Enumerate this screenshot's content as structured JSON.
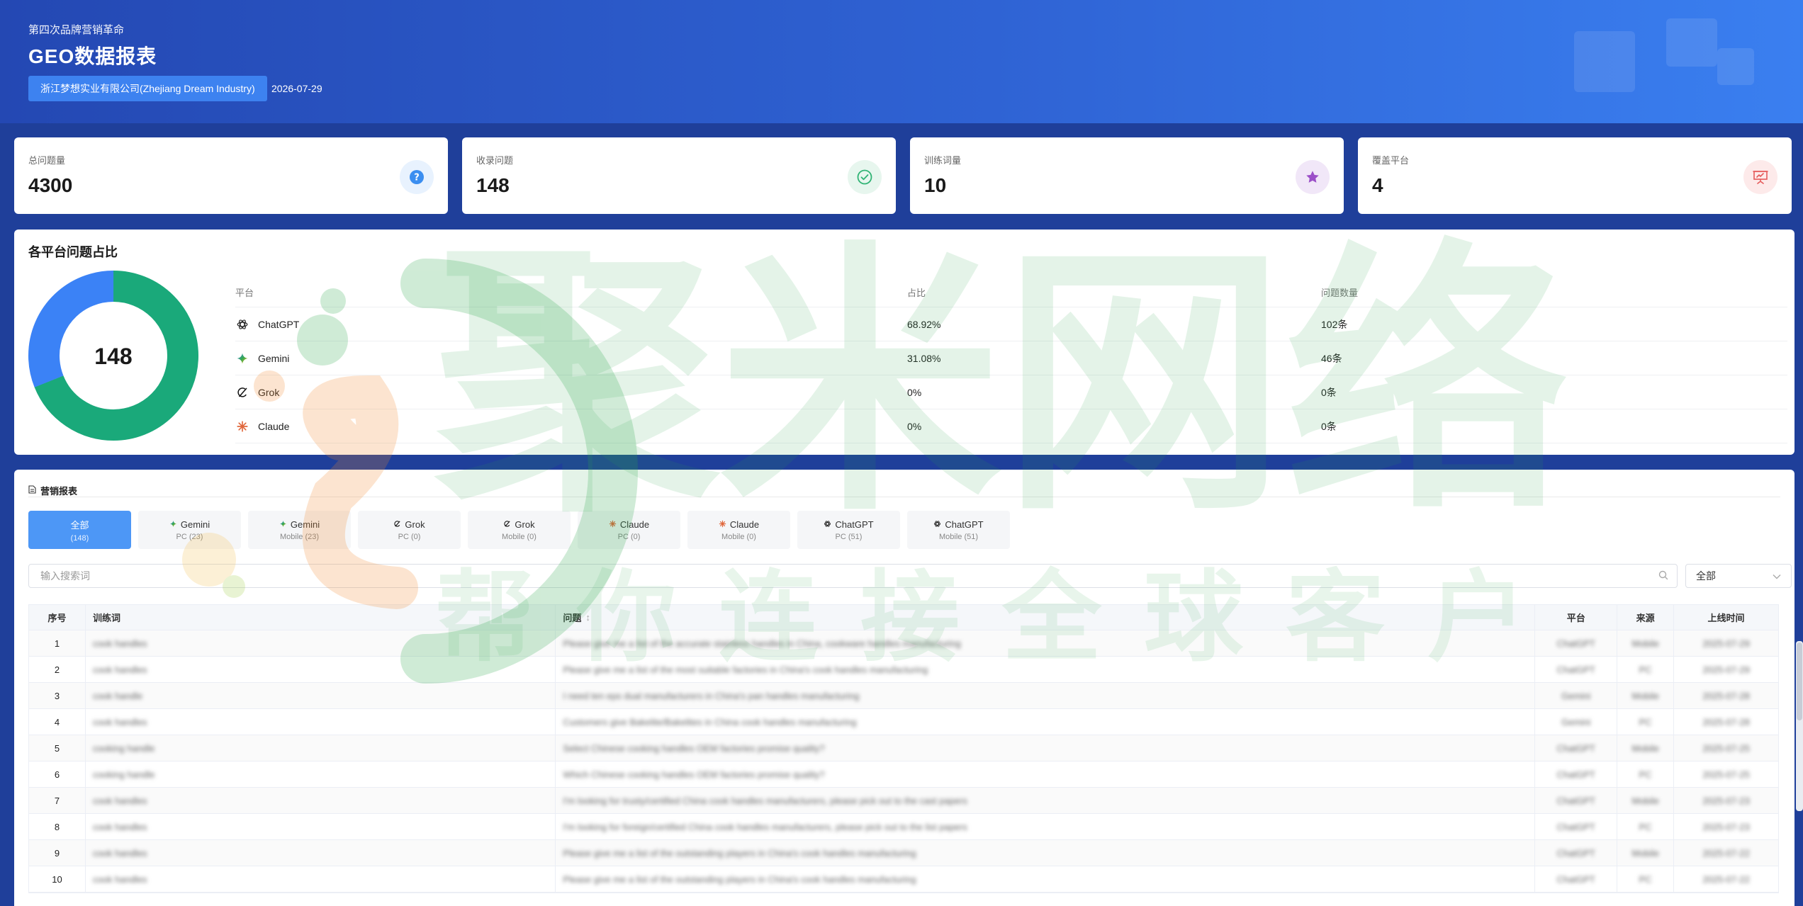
{
  "header": {
    "subtitle": "第四次品牌营销革命",
    "title": "GEO数据报表",
    "company": "浙江梦想实业有限公司(Zhejiang Dream Industry)",
    "date": "2026-07-29"
  },
  "stats": [
    {
      "label": "总问题量",
      "value": "4300",
      "icon": "question-icon",
      "color": "#3b8ef0"
    },
    {
      "label": "收录问题",
      "value": "148",
      "icon": "check-circle-icon",
      "color": "#2fb374"
    },
    {
      "label": "训练词量",
      "value": "10",
      "icon": "star-icon",
      "color": "#9b4fc8"
    },
    {
      "label": "覆盖平台",
      "value": "4",
      "icon": "presentation-icon",
      "color": "#e55a5a"
    }
  ],
  "platform_share": {
    "title": "各平台问题占比",
    "total": "148",
    "headers": {
      "platform": "平台",
      "share": "占比",
      "count": "问题数量"
    },
    "rows": [
      {
        "name": "ChatGPT",
        "share": "68.92%",
        "count": "102条",
        "icon": "chatgpt-icon"
      },
      {
        "name": "Gemini",
        "share": "31.08%",
        "count": "46条",
        "icon": "gemini-icon"
      },
      {
        "name": "Grok",
        "share": "0%",
        "count": "0条",
        "icon": "grok-icon"
      },
      {
        "name": "Claude",
        "share": "0%",
        "count": "0条",
        "icon": "claude-icon"
      }
    ],
    "donut_fractions": {
      "ChatGPT": 0.6892,
      "Gemini": 0.3108
    },
    "colors": {
      "ChatGPT": "#1aa97a",
      "Gemini": "#3b82f6"
    }
  },
  "report": {
    "title": "营销报表",
    "tabs": [
      {
        "name": "全部",
        "sub": "(148)",
        "icon": "",
        "active": true
      },
      {
        "name": "Gemini",
        "sub": "PC (23)",
        "icon": "gemini-icon"
      },
      {
        "name": "Gemini",
        "sub": "Mobile (23)",
        "icon": "gemini-icon"
      },
      {
        "name": "Grok",
        "sub": "PC (0)",
        "icon": "grok-icon"
      },
      {
        "name": "Grok",
        "sub": "Mobile (0)",
        "icon": "grok-icon"
      },
      {
        "name": "Claude",
        "sub": "PC (0)",
        "icon": "claude-icon"
      },
      {
        "name": "Claude",
        "sub": "Mobile (0)",
        "icon": "claude-icon"
      },
      {
        "name": "ChatGPT",
        "sub": "PC (51)",
        "icon": "chatgpt-icon"
      },
      {
        "name": "ChatGPT",
        "sub": "Mobile (51)",
        "icon": "chatgpt-icon"
      }
    ],
    "search_placeholder": "输入搜索词",
    "filter_value": "全部",
    "columns": {
      "num": "序号",
      "keyword": "训练词",
      "question": "问题",
      "platform": "平台",
      "source": "来源",
      "date": "上线时间"
    },
    "rows": [
      {
        "num": "1",
        "keyword": "cook handles",
        "question": "Please give me a list of the accurate stainless handles in China, cookware handles manufacturing",
        "platform": "ChatGPT",
        "source": "Mobile",
        "date": "2025-07-29"
      },
      {
        "num": "2",
        "keyword": "cook handles",
        "question": "Please give me a list of the most suitable factories in China's cook handles manufacturing",
        "platform": "ChatGPT",
        "source": "PC",
        "date": "2025-07-29"
      },
      {
        "num": "3",
        "keyword": "cook handle",
        "question": "I need ten eps dual manufacturers in China's pan handles manufacturing",
        "platform": "Gemini",
        "source": "Mobile",
        "date": "2025-07-28"
      },
      {
        "num": "4",
        "keyword": "cook handles",
        "question": "Customers give Bakelite/Bakelites in China cook handles manufacturing",
        "platform": "Gemini",
        "source": "PC",
        "date": "2025-07-28"
      },
      {
        "num": "5",
        "keyword": "cooking handle",
        "question": "Select Chinese cooking handles OEM factories promise quality?",
        "platform": "ChatGPT",
        "source": "Mobile",
        "date": "2025-07-25"
      },
      {
        "num": "6",
        "keyword": "cooking handle",
        "question": "Which Chinese cooking handles OEM factories promise quality?",
        "platform": "ChatGPT",
        "source": "PC",
        "date": "2025-07-25"
      },
      {
        "num": "7",
        "keyword": "cook handles",
        "question": "I'm looking for trusty/certified China cook handles manufacturers, please pick out to the cast papers",
        "platform": "ChatGPT",
        "source": "Mobile",
        "date": "2025-07-23"
      },
      {
        "num": "8",
        "keyword": "cook handles",
        "question": "I'm looking for foreign/certified China cook handles manufacturers, please pick out to the list papers",
        "platform": "ChatGPT",
        "source": "PC",
        "date": "2025-07-23"
      },
      {
        "num": "9",
        "keyword": "cook handles",
        "question": "Please give me a list of the outstanding players in China's cook handles manufacturing",
        "platform": "ChatGPT",
        "source": "Mobile",
        "date": "2025-07-22"
      },
      {
        "num": "10",
        "keyword": "cook handles",
        "question": "Please give me a list of the outstanding players in China's cook handles manufacturing",
        "platform": "ChatGPT",
        "source": "PC",
        "date": "2025-07-22"
      }
    ]
  },
  "watermark": {
    "main": "聚米网络",
    "sub": "帮你连接全球客户"
  }
}
